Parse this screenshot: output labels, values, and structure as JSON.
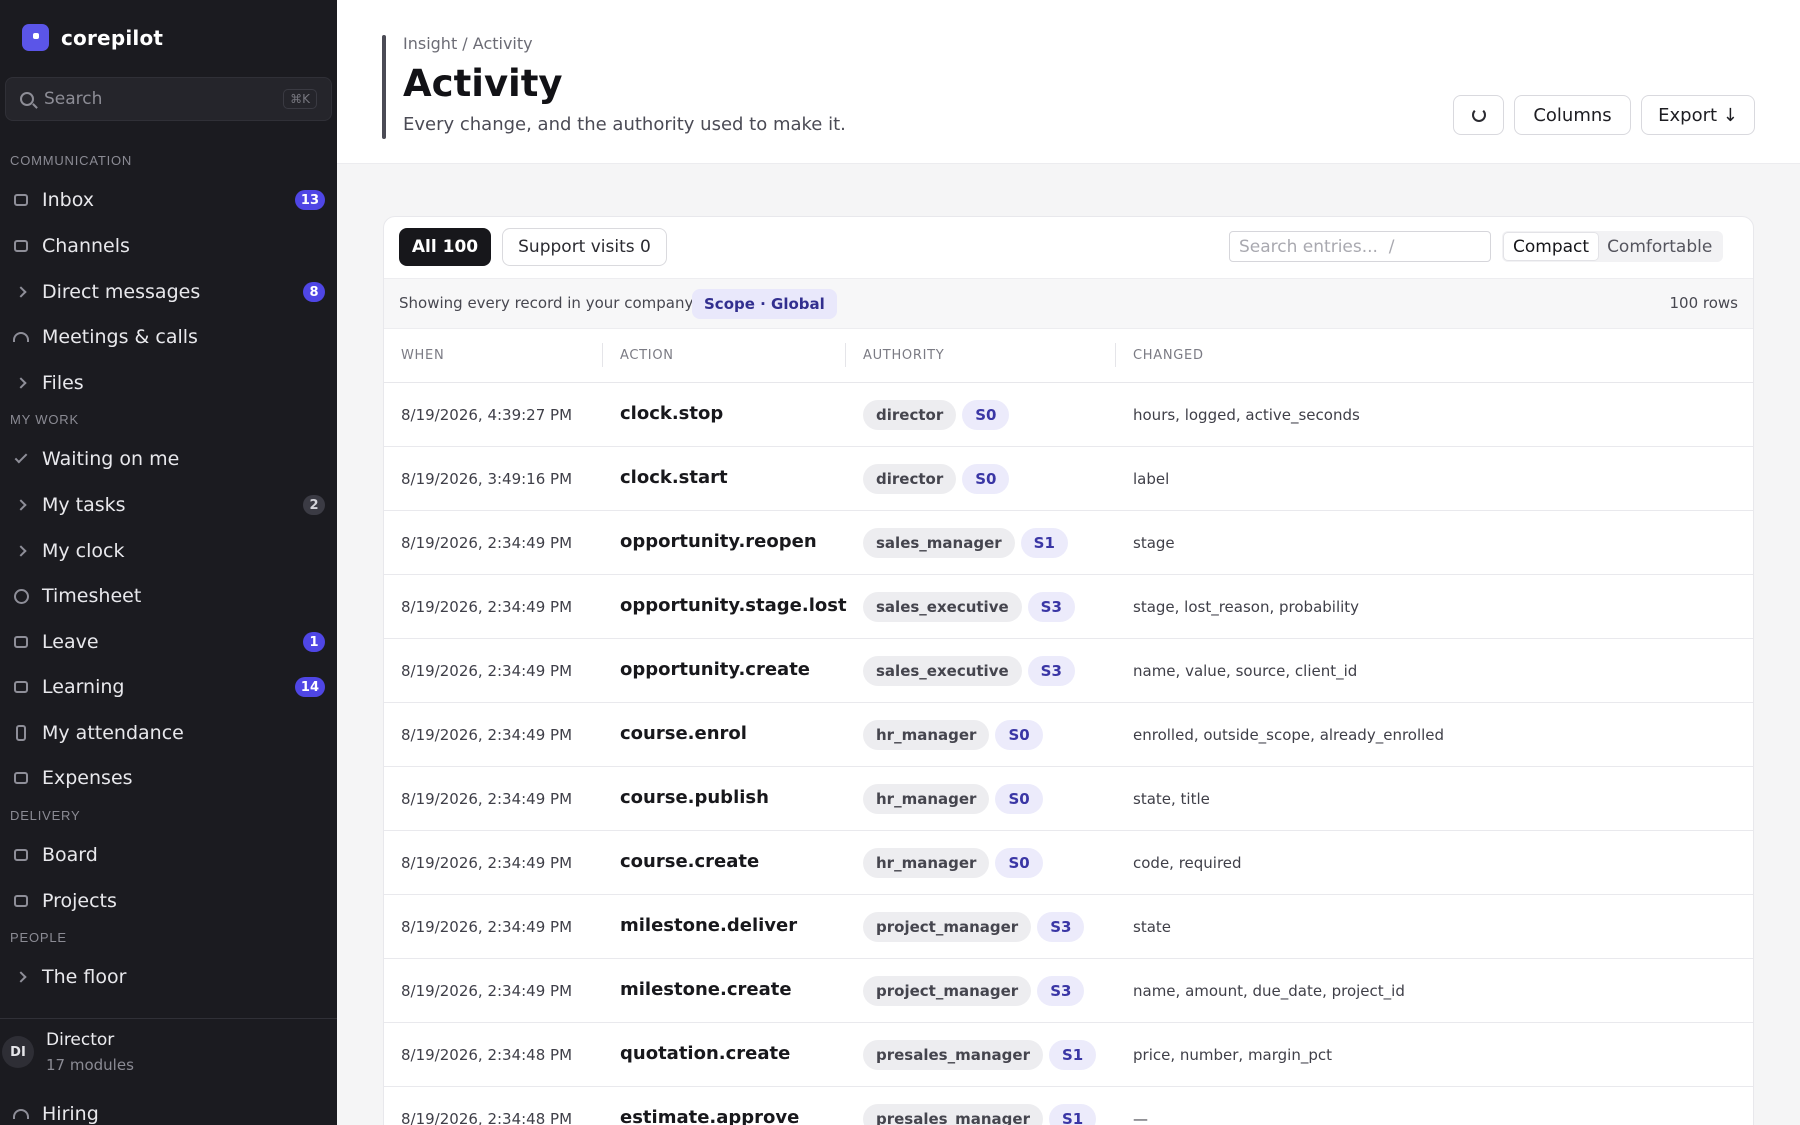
{
  "app": {
    "name": "corepilot"
  },
  "sidebar": {
    "search": {
      "placeholder": "Search",
      "shortcut": "⌘K"
    },
    "sections": {
      "communication": "COMMUNICATION",
      "my_work": "MY WORK",
      "delivery": "DELIVERY",
      "people": "PEOPLE"
    },
    "items": {
      "inbox": {
        "label": "Inbox",
        "badge": "13"
      },
      "channels": {
        "label": "Channels"
      },
      "direct_messages": {
        "label": "Direct messages",
        "badge": "8"
      },
      "meetings": {
        "label": "Meetings & calls"
      },
      "files": {
        "label": "Files"
      },
      "waiting": {
        "label": "Waiting on me"
      },
      "tasks": {
        "label": "My tasks",
        "badge": "2"
      },
      "clock": {
        "label": "My clock"
      },
      "timesheet": {
        "label": "Timesheet"
      },
      "leave": {
        "label": "Leave",
        "badge": "1"
      },
      "learning": {
        "label": "Learning",
        "badge": "14"
      },
      "attendance": {
        "label": "My attendance"
      },
      "expenses": {
        "label": "Expenses"
      },
      "board": {
        "label": "Board"
      },
      "projects": {
        "label": "Projects"
      },
      "floor": {
        "label": "The floor"
      },
      "hiring": {
        "label": "Hiring"
      }
    },
    "profile": {
      "initials": "DI",
      "name": "Director",
      "modules": "17 modules"
    }
  },
  "header": {
    "breadcrumb": "Insight / Activity",
    "title": "Activity",
    "subtitle": "Every change, and the authority used to make it.",
    "columns_label": "Columns",
    "export_label": "Export ↓"
  },
  "toolbar": {
    "tab_all": "All 100",
    "tab_support": "Support visits 0",
    "search_placeholder": "Search entries...  /",
    "density_compact": "Compact",
    "density_comfortable": "Comfortable"
  },
  "scope": {
    "text": "Showing every record in your company",
    "badge": "Scope · Global",
    "rows": "100 rows"
  },
  "table": {
    "columns": [
      "WHEN",
      "ACTION",
      "AUTHORITY",
      "CHANGED"
    ],
    "rows": [
      {
        "when": "8/19/2026, 4:39:27 PM",
        "action": "clock.stop",
        "role": "director",
        "level": "S0",
        "changed": "hours, logged, active_seconds"
      },
      {
        "when": "8/19/2026, 3:49:16 PM",
        "action": "clock.start",
        "role": "director",
        "level": "S0",
        "changed": "label"
      },
      {
        "when": "8/19/2026, 2:34:49 PM",
        "action": "opportunity.reopen",
        "role": "sales_manager",
        "level": "S1",
        "changed": "stage"
      },
      {
        "when": "8/19/2026, 2:34:49 PM",
        "action": "opportunity.stage.lost",
        "role": "sales_executive",
        "level": "S3",
        "changed": "stage, lost_reason, probability"
      },
      {
        "when": "8/19/2026, 2:34:49 PM",
        "action": "opportunity.create",
        "role": "sales_executive",
        "level": "S3",
        "changed": "name, value, source, client_id"
      },
      {
        "when": "8/19/2026, 2:34:49 PM",
        "action": "course.enrol",
        "role": "hr_manager",
        "level": "S0",
        "changed": "enrolled, outside_scope, already_enrolled"
      },
      {
        "when": "8/19/2026, 2:34:49 PM",
        "action": "course.publish",
        "role": "hr_manager",
        "level": "S0",
        "changed": "state, title"
      },
      {
        "when": "8/19/2026, 2:34:49 PM",
        "action": "course.create",
        "role": "hr_manager",
        "level": "S0",
        "changed": "code, required"
      },
      {
        "when": "8/19/2026, 2:34:49 PM",
        "action": "milestone.deliver",
        "role": "project_manager",
        "level": "S3",
        "changed": "state"
      },
      {
        "when": "8/19/2026, 2:34:49 PM",
        "action": "milestone.create",
        "role": "project_manager",
        "level": "S3",
        "changed": "name, amount, due_date, project_id"
      },
      {
        "when": "8/19/2026, 2:34:48 PM",
        "action": "quotation.create",
        "role": "presales_manager",
        "level": "S1",
        "changed": "price, number, margin_pct"
      },
      {
        "when": "8/19/2026, 2:34:48 PM",
        "action": "estimate.approve",
        "role": "presales_manager",
        "level": "S1",
        "changed": "—"
      }
    ]
  }
}
